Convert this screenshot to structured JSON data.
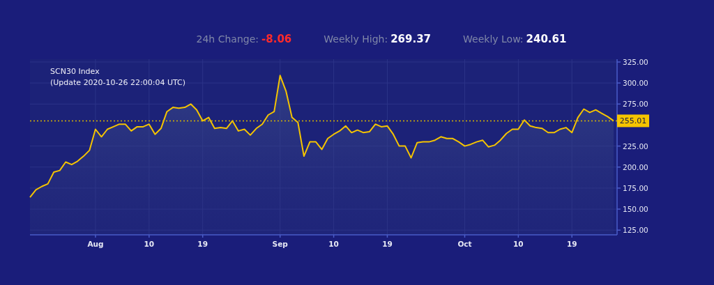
{
  "stats": [
    {
      "label": "24h Change:",
      "value": "-8.06",
      "color": "#ff2a2a"
    },
    {
      "label": "Weekly High:",
      "value": "269.37",
      "color": "#ffffff"
    },
    {
      "label": "Weekly Low:",
      "value": "240.61",
      "color": "#ffffff"
    }
  ],
  "chart": {
    "chart_data": {
      "type": "area",
      "title": "SCN30 Index",
      "categories": [
        null,
        null,
        null,
        null,
        null,
        null,
        null,
        null,
        null,
        null,
        null,
        "Aug",
        null,
        null,
        null,
        null,
        null,
        null,
        null,
        null,
        "10",
        null,
        null,
        null,
        null,
        null,
        null,
        null,
        null,
        "19",
        null,
        null,
        null,
        null,
        null,
        null,
        null,
        null,
        null,
        null,
        null,
        null,
        "Sep",
        null,
        null,
        null,
        null,
        null,
        null,
        null,
        null,
        "10",
        null,
        null,
        null,
        null,
        null,
        null,
        null,
        null,
        "19",
        null,
        null,
        null,
        null,
        null,
        null,
        null,
        null,
        null,
        null,
        null,
        null,
        "Oct",
        null,
        null,
        null,
        null,
        null,
        null,
        null,
        null,
        "10",
        null,
        null,
        null,
        null,
        null,
        null,
        null,
        null,
        "19",
        null,
        null,
        null,
        null,
        null,
        null,
        null
      ],
      "series": [
        {
          "color": "#f5c400",
          "values": [
            164,
            173,
            177,
            180,
            194,
            196,
            206,
            203,
            207,
            213,
            220,
            245,
            236,
            245,
            248,
            251,
            251,
            243,
            248,
            248,
            251,
            239,
            246,
            266,
            271,
            270,
            271,
            275,
            268,
            255,
            259,
            246,
            247,
            246,
            255,
            243,
            245,
            238,
            246,
            251,
            262,
            266,
            309,
            290,
            259,
            253,
            213,
            230,
            230,
            221,
            234,
            239,
            243,
            249,
            241,
            244,
            241,
            242,
            251,
            248,
            249,
            239,
            225,
            225,
            211,
            229,
            230,
            230,
            232,
            236,
            234,
            234,
            230,
            225,
            227,
            230,
            232,
            224,
            226,
            232,
            240,
            245,
            245,
            256,
            249,
            247,
            246,
            241,
            241,
            245,
            247,
            241,
            259,
            269,
            265,
            268,
            264,
            260,
            255
          ]
        }
      ],
      "ylim": [
        119.4,
        328.3
      ],
      "yticks": [
        {
          "value": 125,
          "label": "125.00"
        },
        {
          "value": 150,
          "label": "150.00"
        },
        {
          "value": 175,
          "label": "175.00"
        },
        {
          "value": 200,
          "label": "200.00"
        },
        {
          "value": 225,
          "label": "225.00"
        },
        {
          "value": 275,
          "label": "275.00"
        },
        {
          "value": 300,
          "label": "300.00"
        },
        {
          "value": 325,
          "label": "325.00"
        }
      ],
      "annotations": [
        {
          "text": "(Update 2020-10-26 22:00:04 UTC)"
        }
      ],
      "ref_lines": [
        {
          "axis": "y",
          "value": 255.01,
          "label": "255.01"
        }
      ],
      "grid": true
    }
  }
}
